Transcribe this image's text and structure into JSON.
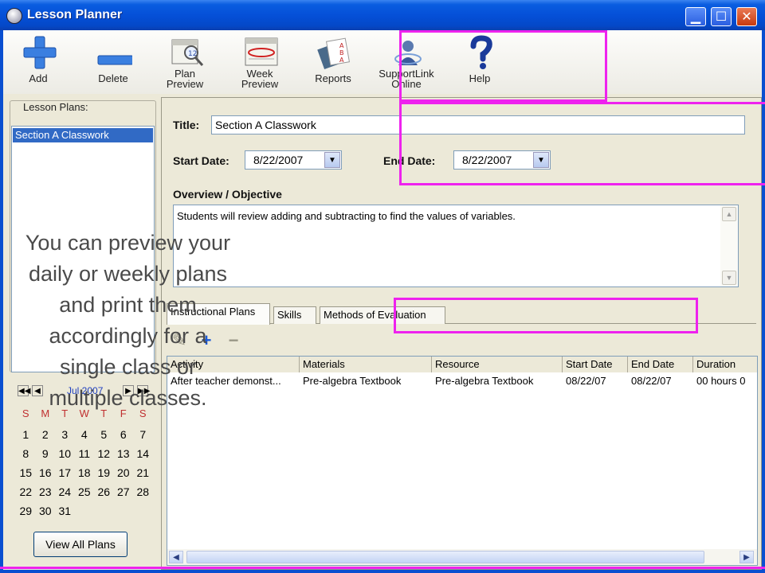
{
  "window": {
    "title": "Lesson Planner"
  },
  "toolbar": {
    "add": "Add",
    "delete": "Delete",
    "plan_preview": [
      "Plan",
      "Preview"
    ],
    "week_preview": [
      "Week",
      "Preview"
    ],
    "reports": "Reports",
    "supportlink": [
      "SupportLink",
      "Online"
    ],
    "help": "Help"
  },
  "lesson_plans": {
    "legend": "Lesson Plans:",
    "items": [
      "Section A Classwork"
    ]
  },
  "calendar": {
    "month": "Jul 2007",
    "day_headers": [
      "S",
      "M",
      "T",
      "W",
      "T",
      "F",
      "S"
    ],
    "days": [
      "1",
      "2",
      "3",
      "4",
      "5",
      "6",
      "7",
      "8",
      "9",
      "10",
      "11",
      "12",
      "13",
      "14",
      "15",
      "16",
      "17",
      "18",
      "19",
      "20",
      "21",
      "22",
      "23",
      "24",
      "25",
      "26",
      "27",
      "28",
      "29",
      "30",
      "31"
    ]
  },
  "view_all_label": "View All Plans",
  "form": {
    "title_label": "Title:",
    "title_value": "Section A Classwork",
    "start_label": "Start Date:",
    "start_value": "8/22/2007",
    "end_label": "End Date:",
    "end_value": "8/22/2007",
    "overview_label": "Overview / Objective",
    "overview_text": "Students will review adding and subtracting to find the values of variables."
  },
  "tabs": [
    "Instructional Plans",
    "Skills",
    "Methods of Evaluation"
  ],
  "grid": {
    "columns": [
      "Activity",
      "Materials",
      "Resource",
      "Start Date",
      "End Date",
      "Duration"
    ],
    "rows": [
      [
        "After teacher demonst...",
        "Pre-algebra Textbook",
        "Pre-algebra Textbook",
        "08/22/07",
        "08/22/07",
        "00 hours 0"
      ]
    ]
  },
  "caption": "You can preview your daily or weekly plans and print them accordingly for a single class or multiple classes.",
  "colors": {
    "highlight": "#ee22ee",
    "titlebar": "#0550d8",
    "selection": "#316ac5"
  }
}
